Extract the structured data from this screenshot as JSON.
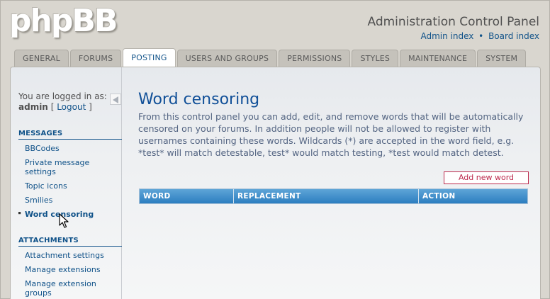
{
  "header": {
    "logo_text": "phpBB",
    "title": "Administration Control Panel",
    "links": {
      "admin_index": "Admin index",
      "separator": "•",
      "board_index": "Board index"
    }
  },
  "tabs": [
    {
      "label": "GENERAL"
    },
    {
      "label": "FORUMS"
    },
    {
      "label": "POSTING",
      "active": true
    },
    {
      "label": "USERS AND GROUPS"
    },
    {
      "label": "PERMISSIONS"
    },
    {
      "label": "STYLES"
    },
    {
      "label": "MAINTENANCE"
    },
    {
      "label": "SYSTEM"
    }
  ],
  "sidebar": {
    "logged_in_prefix": "You are logged in as:",
    "username": "admin",
    "bracket_open": "[",
    "logout": "Logout",
    "bracket_close": "]",
    "sections": [
      {
        "heading": "MESSAGES",
        "items": [
          {
            "label": "BBCodes"
          },
          {
            "label": "Private message settings"
          },
          {
            "label": "Topic icons"
          },
          {
            "label": "Smilies"
          },
          {
            "label": "Word censoring",
            "active": true
          }
        ]
      },
      {
        "heading": "ATTACHMENTS",
        "items": [
          {
            "label": "Attachment settings"
          },
          {
            "label": "Manage extensions"
          },
          {
            "label": "Manage extension groups"
          }
        ]
      }
    ]
  },
  "main": {
    "title": "Word censoring",
    "description": "From this control panel you can add, edit, and remove words that will be automatically censored on your forums. In addition people will not be allowed to register with usernames containing these words. Wildcards (*) are accepted in the word field, e.g. *test* will match detestable, test* would match testing, *test would match detest.",
    "add_button": "Add new word",
    "table_headers": [
      "WORD",
      "REPLACEMENT",
      "ACTION"
    ]
  },
  "colors": {
    "link": "#105289",
    "title": "#115098",
    "button_border": "#bc2a4d",
    "table_header": "#2c7ec0"
  }
}
